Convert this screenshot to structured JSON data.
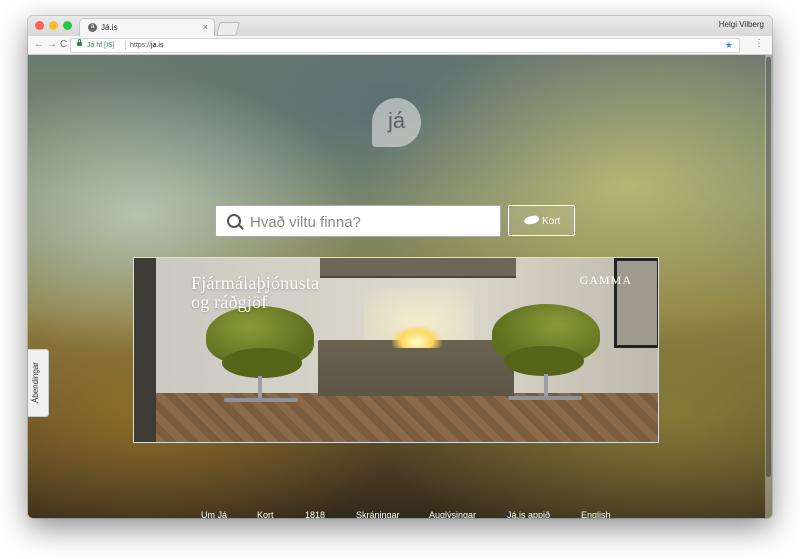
{
  "browser": {
    "tab_title": "Já.is",
    "tab_close": "×",
    "profile_name": "Helgi Vilberg",
    "security_label": "Já hf [IS]",
    "url_scheme": "https://",
    "url_host": "ja.is",
    "back_glyph": "←",
    "forward_glyph": "→",
    "reload_glyph": "C",
    "star_glyph": "★",
    "menu_glyph": "⋮",
    "favicon_glyph": "á"
  },
  "page": {
    "logo_text": "já",
    "search": {
      "placeholder": "Hvað viltu finna?",
      "value": ""
    },
    "map_button_label": "Kort",
    "feedback_tab": "Ábendingar",
    "ad": {
      "headline_line1": "Fjármálaþjónusta",
      "headline_line2": "og ráðgjöf",
      "brand": "GAMMA"
    },
    "footer_links": [
      "Um Já",
      "Kort",
      "1818",
      "Skráningar",
      "Auglýsingar",
      "Já.is appið",
      "English"
    ]
  },
  "colors": {
    "traffic_red": "#ff5f57",
    "traffic_yellow": "#ffbd2e",
    "traffic_green": "#28c940",
    "secure_green": "#1f8e3d",
    "bookmark_star": "#4a86e8"
  }
}
